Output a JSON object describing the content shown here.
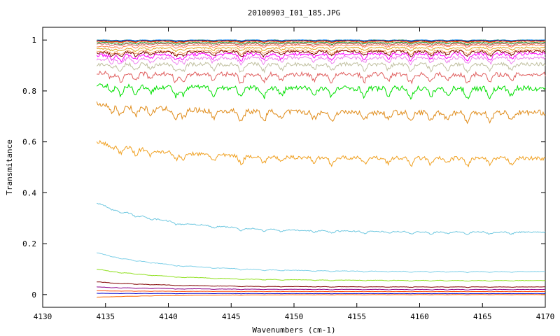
{
  "chart_data": {
    "type": "line",
    "title": "20100903_I01_185.JPG",
    "xlabel": "Wavenumbers (cm-1)",
    "ylabel": "Transmitance",
    "xlim": [
      4130,
      4170
    ],
    "ylim": [
      -0.05,
      1.05
    ],
    "x_ticks": [
      4130,
      4135,
      4140,
      4145,
      4150,
      4155,
      4160,
      4165,
      4170
    ],
    "x_tick_labels": [
      "4130",
      "4135",
      "4140",
      "4145",
      "4150",
      "4155",
      "4160",
      "4165",
      "4170"
    ],
    "y_ticks": [
      0,
      0.2,
      0.4,
      0.6,
      0.8,
      1
    ],
    "y_tick_labels": [
      "0",
      "0.2",
      "0.4",
      "0.6",
      "0.8",
      "1"
    ],
    "x_range": [
      4134.3,
      4170
    ],
    "grid": false,
    "legend": "none",
    "absorption_lines": [
      4135.5,
      4136.2,
      4137.4,
      4138.6,
      4140.6,
      4141.2,
      4143.6,
      4145.8,
      4147.6,
      4149.0,
      4151.6,
      4153.0,
      4155.6,
      4157.5,
      4159.3,
      4160.9,
      4162.2,
      4163.8,
      4165.6,
      4167.3
    ],
    "series": [
      {
        "color": "#2e8b57",
        "start": 1.0,
        "end": 1.0,
        "depth": 0.003
      },
      {
        "color": "#1e90ff",
        "start": 1.0,
        "end": 1.0,
        "depth": 0.004
      },
      {
        "color": "#000080",
        "start": 0.998,
        "end": 0.998,
        "depth": 0.004
      },
      {
        "color": "#8b4513",
        "start": 0.996,
        "end": 0.996,
        "depth": 0.005
      },
      {
        "color": "#ff4500",
        "start": 0.995,
        "end": 0.995,
        "depth": 0.006
      },
      {
        "color": "#228b22",
        "start": 0.99,
        "end": 0.99,
        "depth": 0.007
      },
      {
        "color": "#cd5c5c",
        "start": 0.985,
        "end": 0.985,
        "depth": 0.008
      },
      {
        "color": "#ff7f50",
        "start": 0.975,
        "end": 0.98,
        "depth": 0.01
      },
      {
        "color": "#daa520",
        "start": 0.965,
        "end": 0.97,
        "depth": 0.012
      },
      {
        "color": "#f4a460",
        "start": 0.955,
        "end": 0.96,
        "depth": 0.015
      },
      {
        "color": "#800000",
        "start": 0.95,
        "end": 0.955,
        "depth": 0.02
      },
      {
        "color": "#ff00ff",
        "start": 0.94,
        "end": 0.945,
        "depth": 0.025
      },
      {
        "color": "#ee82ee",
        "start": 0.925,
        "end": 0.93,
        "depth": 0.025
      },
      {
        "color": "#c0c0a0",
        "start": 0.905,
        "end": 0.905,
        "depth": 0.03
      },
      {
        "color": "#e06060",
        "start": 0.87,
        "end": 0.865,
        "depth": 0.035
      },
      {
        "color": "#00e000",
        "start": 0.825,
        "end": 0.81,
        "depth": 0.04
      },
      {
        "color": "#e08c1a",
        "start": 0.75,
        "end": 0.715,
        "depth": 0.04
      },
      {
        "color": "#f0a020",
        "start": 0.6,
        "end": 0.535,
        "depth": 0.03
      },
      {
        "color": "#70c8e0",
        "start": 0.36,
        "end": 0.245,
        "depth": 0.01
      },
      {
        "color": "#80d0e8",
        "start": 0.165,
        "end": 0.09,
        "depth": 0.004
      },
      {
        "color": "#90e020",
        "start": 0.1,
        "end": 0.055,
        "depth": 0.003
      },
      {
        "color": "#800000",
        "start": 0.05,
        "end": 0.03,
        "depth": 0.002
      },
      {
        "color": "#8b008b",
        "start": 0.03,
        "end": 0.02,
        "depth": 0.002
      },
      {
        "color": "#ff4500",
        "start": 0.015,
        "end": 0.012,
        "depth": 0.001
      },
      {
        "color": "#0000cd",
        "start": 0.005,
        "end": 0.004,
        "depth": 0.001
      },
      {
        "color": "#ff6600",
        "start": -0.01,
        "end": 0.0,
        "depth": 0.001
      }
    ]
  }
}
